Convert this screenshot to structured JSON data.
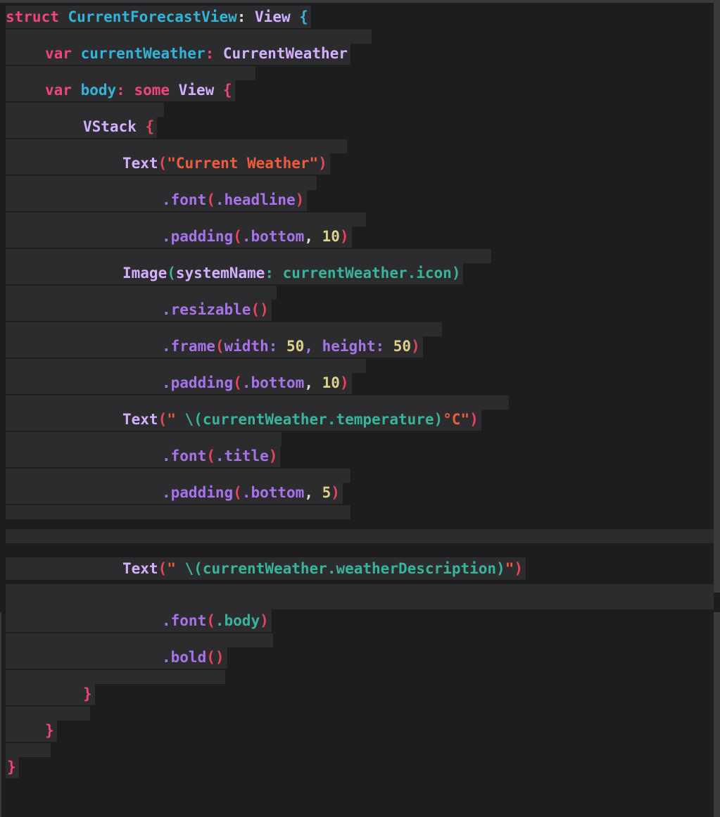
{
  "code": {
    "line1": {
      "kw": "struct ",
      "name": "CurrentForecastView",
      "colon": ": ",
      "type": "View",
      "brace": " {"
    },
    "line2": {
      "kw": "var ",
      "name": "currentWeather",
      "colon": ": ",
      "type": "CurrentWeather"
    },
    "line3": {
      "kw": "var ",
      "name": "body",
      "colon": ": ",
      "kw2": "some ",
      "type": "View",
      "brace": " {"
    },
    "line4": {
      "type": "VStack",
      "brace": " {"
    },
    "line5": {
      "type": "Text",
      "open": "(",
      "str": "\"Current Weather\"",
      "close": ")"
    },
    "line6": {
      "mod": ".font",
      "open": "(",
      "arg": ".headline",
      "close": ")"
    },
    "line7": {
      "mod": ".padding",
      "open": "(",
      "arg": ".bottom",
      "comma": ", ",
      "num": "10",
      "close": ")"
    },
    "line8": {
      "type": "Image",
      "open": "(",
      "label": "systemName",
      "colon": ": ",
      "arg": "currentWeather.icon",
      "close": ")"
    },
    "line9": {
      "mod": ".resizable",
      "parens": "()"
    },
    "line10": {
      "mod": ".frame",
      "open": "(",
      "label1": "width",
      "colon1": ": ",
      "num1": "50",
      "comma": ", ",
      "label2": "height",
      "colon2": ": ",
      "num2": "50",
      "close": ")"
    },
    "line11": {
      "mod": ".padding",
      "open": "(",
      "arg": ".bottom",
      "comma": ", ",
      "num": "10",
      "close": ")"
    },
    "line12": {
      "type": "Text",
      "open": "(",
      "q1": "\" ",
      "interp": "\\(currentWeather.temperature)",
      "q2": "°C\"",
      "close": ")"
    },
    "line13": {
      "mod": ".font",
      "open": "(",
      "arg": ".title",
      "close": ")"
    },
    "line14": {
      "mod": ".padding",
      "open": "(",
      "arg": ".bottom",
      "comma": ", ",
      "num": "5",
      "close": ")"
    },
    "line15": {
      "type": "Text",
      "open": "(",
      "q1": "\" ",
      "interp": "\\(currentWeather.weatherDescription)",
      "q2": "\"",
      "close": ")"
    },
    "line16": {
      "mod": ".font",
      "open": "(",
      "arg": ".body",
      "close": ")"
    },
    "line17": {
      "mod": ".bold",
      "parens": "()"
    },
    "line18": {
      "brace": "}"
    },
    "line19": {
      "brace": "}"
    },
    "line20": {
      "brace": "}"
    }
  },
  "colors": {
    "background": "#1d1d20",
    "line_highlight": "#2c2c2e",
    "keyword": "#f0447f",
    "type_name": "#32b4d9",
    "type_ref": "#d2b0ff",
    "string": "#ef5c3b",
    "modifier": "#a673e8",
    "property": "#38b49a",
    "number": "#ded08a"
  }
}
